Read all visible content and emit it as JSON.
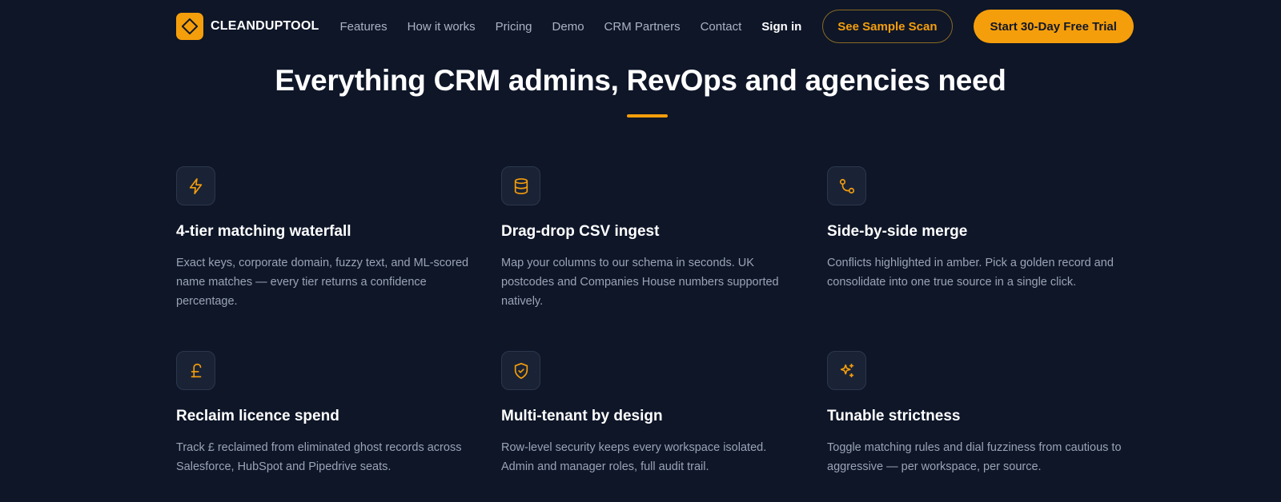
{
  "brand": {
    "name": "CLEANDUPTOOL",
    "accent_color": "#f59e0b",
    "background_color": "#0e1628"
  },
  "nav": {
    "links": [
      "Features",
      "How it works",
      "Pricing",
      "Demo",
      "CRM Partners",
      "Contact"
    ],
    "signin": "Sign in",
    "sample_scan": "See Sample Scan",
    "trial": "Start 30-Day Free Trial"
  },
  "hero": {
    "headline": "Everything CRM admins, RevOps and agencies need"
  },
  "features": [
    {
      "icon": "lightning-icon",
      "title": "4-tier matching waterfall",
      "description": "Exact keys, corporate domain, fuzzy text, and ML-scored name matches — every tier returns a confidence percentage."
    },
    {
      "icon": "database-icon",
      "title": "Drag-drop CSV ingest",
      "description": "Map your columns to our schema in seconds. UK postcodes and Companies House numbers supported natively."
    },
    {
      "icon": "git-merge-icon",
      "title": "Side-by-side merge",
      "description": "Conflicts highlighted in amber. Pick a golden record and consolidate into one true source in a single click."
    },
    {
      "icon": "pound-icon",
      "title": "Reclaim licence spend",
      "description": "Track £ reclaimed from eliminated ghost records across Salesforce, HubSpot and Pipedrive seats."
    },
    {
      "icon": "shield-check-icon",
      "title": "Multi-tenant by design",
      "description": "Row-level security keeps every workspace isolated. Admin and manager roles, full audit trail."
    },
    {
      "icon": "sparkles-icon",
      "title": "Tunable strictness",
      "description": "Toggle matching rules and dial fuzziness from cautious to aggressive — per workspace, per source."
    }
  ]
}
